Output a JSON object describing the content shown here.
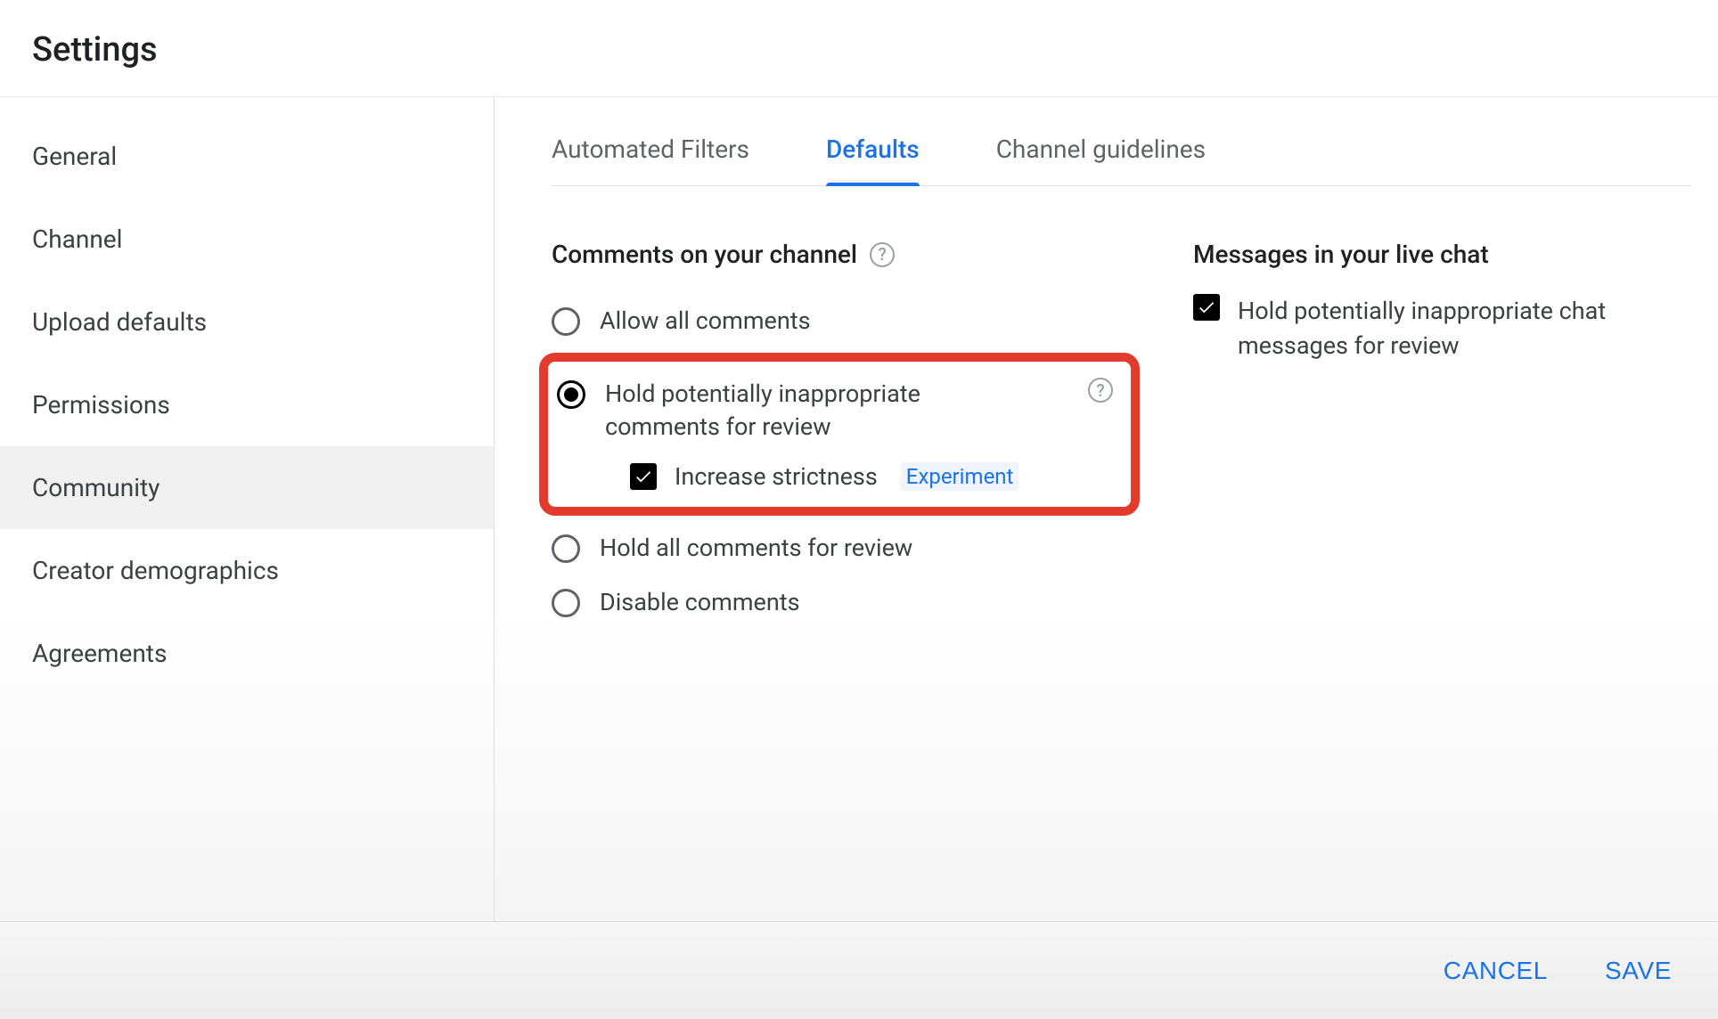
{
  "header": {
    "title": "Settings"
  },
  "sidebar": {
    "items": [
      {
        "label": "General"
      },
      {
        "label": "Channel"
      },
      {
        "label": "Upload defaults"
      },
      {
        "label": "Permissions"
      },
      {
        "label": "Community"
      },
      {
        "label": "Creator demographics"
      },
      {
        "label": "Agreements"
      }
    ],
    "active_index": 4
  },
  "tabs": {
    "items": [
      {
        "label": "Automated Filters"
      },
      {
        "label": "Defaults"
      },
      {
        "label": "Channel guidelines"
      }
    ],
    "active_index": 1
  },
  "comments": {
    "section_title": "Comments on your channel",
    "options": [
      {
        "label": "Allow all comments"
      },
      {
        "label": "Hold potentially inappropriate comments for review"
      },
      {
        "label": "Hold all comments for review"
      },
      {
        "label": "Disable comments"
      }
    ],
    "selected_index": 1,
    "strictness": {
      "label": "Increase strictness",
      "badge": "Experiment",
      "checked": true
    }
  },
  "livechat": {
    "section_title": "Messages in your live chat",
    "option_label": "Hold potentially inappropriate chat messages for review",
    "checked": true
  },
  "footer": {
    "cancel": "CANCEL",
    "save": "SAVE"
  }
}
